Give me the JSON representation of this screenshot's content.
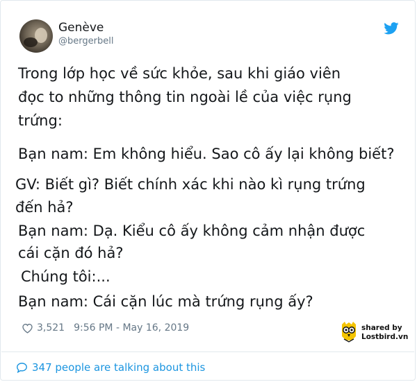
{
  "user": {
    "display_name": "Genève",
    "handle": "@bergerbell"
  },
  "tweet": {
    "lines": [
      "Trong lớp học về sức khỏe, sau khi giáo viên",
      "đọc to những thông tin ngoài lề của việc rụng",
      "trứng:",
      "Bạn nam: Em không hiểu. Sao cô ấy lại không biết?",
      "GV: Biết gì? Biết chính xác khi nào kì rụng trứng",
      "đến hả?",
      "Bạn nam: Dạ. Kiểu cô ấy không cảm nhận được",
      "cái cặn đó hả?",
      "Chúng tôi:...",
      "Bạn nam: Cái cặn lúc mà trứng rụng ấy?"
    ],
    "likes": "3,521",
    "timestamp": "9:56 PM - May 16, 2019"
  },
  "footer": {
    "talking": "347 people are talking about this"
  },
  "watermark": {
    "line1": "shared by",
    "line2": "Lostbird.vn"
  },
  "icons": {
    "brand": "twitter-bird-icon",
    "like": "heart-icon",
    "reply": "speech-bubble-icon"
  },
  "colors": {
    "twitter_blue": "#1da1f2",
    "link_blue": "#1b95e0",
    "muted": "#657786",
    "text": "#14171a"
  }
}
